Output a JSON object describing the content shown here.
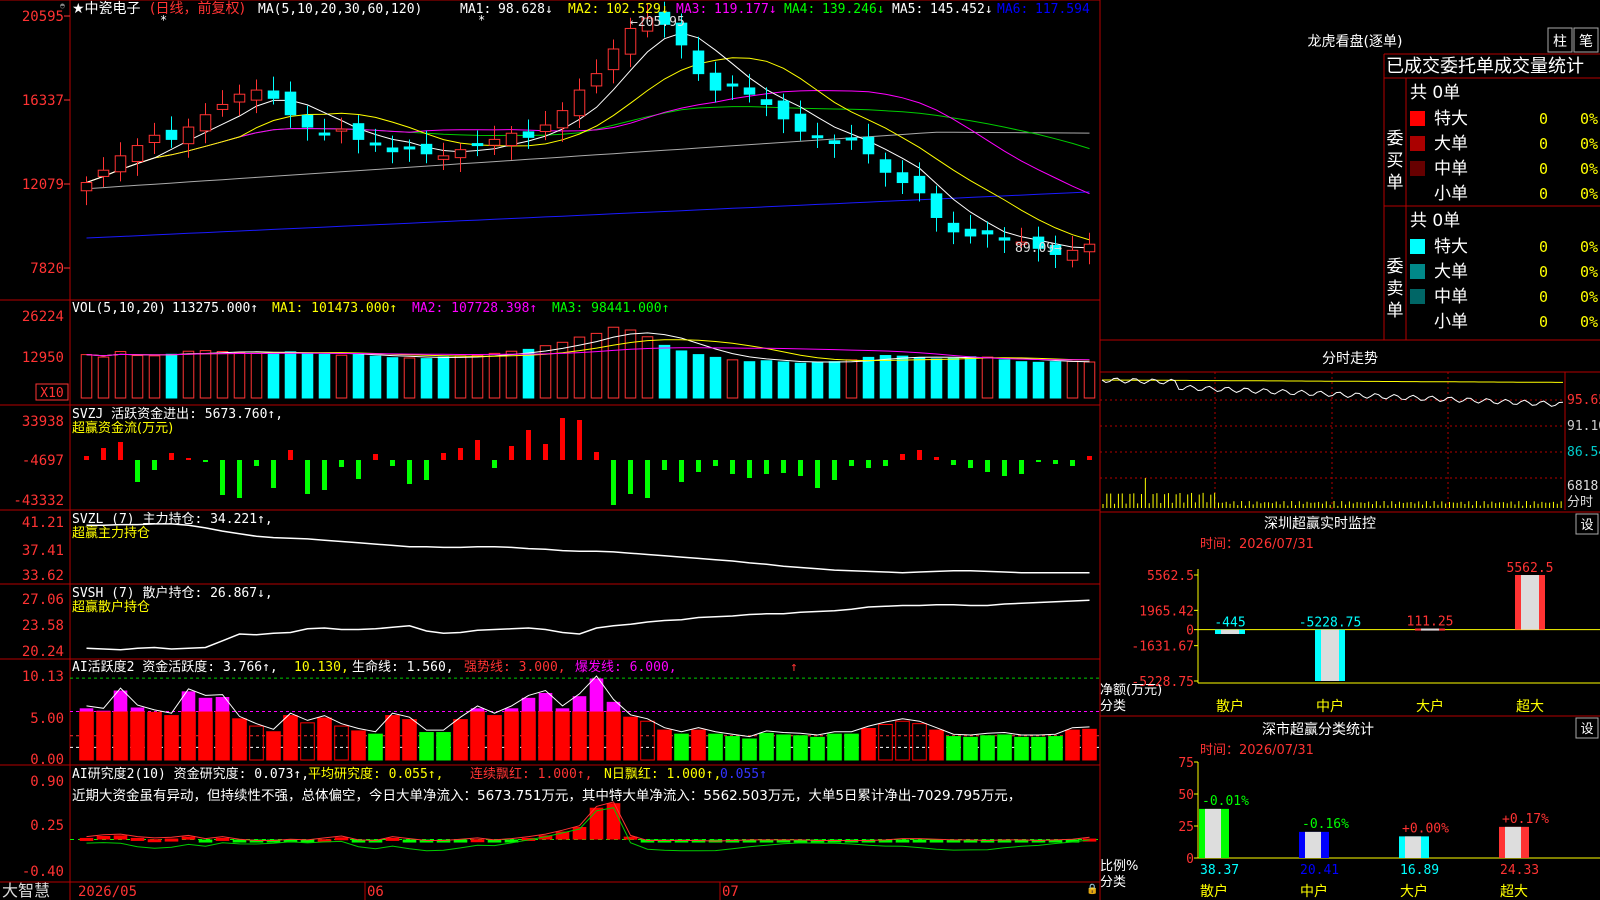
{
  "stock": {
    "star": "★",
    "name": "中瓷电子",
    "period_note": "(日线，前复权)",
    "ma_params": "MA(5,10,20,30,60,120)",
    "ma_readouts": [
      {
        "label": "MA1:",
        "value": "98.628↓",
        "color": "#ffffff"
      },
      {
        "label": "MA2:",
        "value": "102.529↓",
        "color": "#ffff00"
      },
      {
        "label": "MA3:",
        "value": "119.177↓",
        "color": "#ff00ff"
      },
      {
        "label": "MA4:",
        "value": "139.246↓",
        "color": "#00ff00"
      },
      {
        "label": "MA5:",
        "value": "145.452↓",
        "color": "#ffffff"
      },
      {
        "label": "MA6:",
        "value": "117.594",
        "color": "#0000ff"
      }
    ],
    "price_high_label": "←205.95",
    "price_low_label": "89.09→"
  },
  "price_axis": [
    "20595",
    "16337",
    "12079",
    "7820"
  ],
  "volume": {
    "header": "VOL(5,10,20)",
    "value": "113275.000↑",
    "ma1": "MA1: 101473.000↑",
    "ma2": "MA2: 107728.398↑",
    "ma3": "MA3: 98441.000↑",
    "axis": [
      "26224",
      "12950"
    ],
    "unit": "X10"
  },
  "svzj": {
    "header": "SVZJ  活跃资金进出: 5673.760↑,",
    "sub": "超赢资金流(万元)",
    "axis": [
      "33938",
      "-4697",
      "-43332"
    ]
  },
  "svzl": {
    "header": "SVZL (7) 主力持仓: 34.221↑,",
    "sub": "超赢主力持仓",
    "axis": [
      "41.21",
      "37.41",
      "33.62"
    ]
  },
  "svsh": {
    "header": "SVSH (7) 散户持仓: 26.867↓,",
    "sub": "超赢散户持仓",
    "axis": [
      "27.06",
      "23.58",
      "20.24"
    ]
  },
  "ai_active": {
    "header_a": "AI活跃度2 资金活跃度: 3.766↑, ",
    "header_b": "10.130,",
    "header_c": " 生命线: 1.560,",
    "header_d": " 强势线: 3.000,",
    "header_e": " 爆发线: 6.000,",
    "axis": [
      "10.13",
      "5.00",
      "0.00"
    ]
  },
  "ai_research": {
    "h1": "AI研究度2(10) 资金研究度: 0.073↑,",
    "h2": " 平均研究度: 0.055↑,",
    "h3": " 连续飘红: 1.000↑,",
    "h4": " N日飘红: 1.000↑,",
    "h5": " 0.055↑",
    "comment": "近期大资金虽有异动，但持续性不强，总体偏空，今日大单净流入：5673.751万元，其中特大单净流入：5562.503万元，大单5日累计净出-7029.795万元，",
    "axis": [
      "0.90",
      "0.25",
      "-0.40"
    ]
  },
  "date_axis": [
    "2026/05",
    "06",
    "07"
  ],
  "brand": "大智慧",
  "right": {
    "lhb_title": "龙虎看盘(逐单)",
    "btn_zhu": "柱",
    "btn_bi": "笔",
    "table_title": "已成交委托单成交量统计",
    "buy_label": "委买单",
    "sell_label": "委卖单",
    "buy_total": "共 0单",
    "sell_total": "共 0单",
    "buy_rows": [
      {
        "name": "特大",
        "count": "0",
        "pct": "0%",
        "color": "#ff0000"
      },
      {
        "name": "大单",
        "count": "0",
        "pct": "0%",
        "color": "#aa0000"
      },
      {
        "name": "中单",
        "count": "0",
        "pct": "0%",
        "color": "#660000"
      },
      {
        "name": "小单",
        "count": "0",
        "pct": "0%",
        "color": "#000000"
      }
    ],
    "sell_rows": [
      {
        "name": "特大",
        "count": "0",
        "pct": "0%",
        "color": "#00ffff"
      },
      {
        "name": "大单",
        "count": "0",
        "pct": "0%",
        "color": "#008888"
      },
      {
        "name": "中单",
        "count": "0",
        "pct": "0%",
        "color": "#006666"
      },
      {
        "name": "小单",
        "count": "0",
        "pct": "0%",
        "color": "#000000"
      }
    ],
    "intraday_title": "分时走势",
    "intraday_axis": [
      "95.65",
      "91.10",
      "86.54"
    ],
    "intraday_vol": "6818",
    "intraday_vol_unit": "分时",
    "sz_title": "深圳超赢实时监控",
    "sz_time": "时间：2026/07/31",
    "sz_axis": [
      "5562.5",
      "1965.42",
      "0",
      "-1631.67",
      "-5228.75"
    ],
    "sz_ylabel": "净额(万元)",
    "sz_xlabel": "分类",
    "sz_bars": [
      {
        "cat": "散户",
        "value": -445,
        "label": "-445"
      },
      {
        "cat": "中户",
        "value": -5228.75,
        "label": "-5228.75"
      },
      {
        "cat": "大户",
        "value": 111.25,
        "label": "111.25"
      },
      {
        "cat": "超大",
        "value": 5562.5,
        "label": "5562.5"
      }
    ],
    "cls_title": "深市超赢分类统计",
    "cls_time": "时间：2026/07/31",
    "cls_axis": [
      "75",
      "50",
      "25",
      "0"
    ],
    "cls_ylabel": "比例%",
    "cls_xlabel": "分类",
    "cls_bars": [
      {
        "cat": "散户",
        "value": 38.37,
        "label": "38.37",
        "chg": "-0.01%"
      },
      {
        "cat": "中户",
        "value": 20.41,
        "label": "20.41",
        "chg": "-0.16%"
      },
      {
        "cat": "大户",
        "value": 16.89,
        "label": "16.89",
        "chg": "+0.00%"
      },
      {
        "cat": "超大",
        "value": 24.33,
        "label": "24.33",
        "chg": "+0.17%"
      }
    ],
    "set_label": "设"
  },
  "colors": {
    "up": "#ff3333",
    "down": "#00ffff",
    "grid": "#b40000",
    "axis_text": "#ff3333",
    "green": "#00ff00"
  },
  "chart_data": {
    "type": "candlestick",
    "closes": [
      125,
      131,
      138,
      143,
      148,
      146,
      152,
      158,
      163,
      168,
      170,
      166,
      158,
      152,
      149,
      151,
      146,
      144,
      140,
      142,
      139,
      138,
      141,
      143,
      146,
      149,
      147,
      153,
      160,
      170,
      178,
      190,
      200,
      205,
      202,
      192,
      178,
      170,
      172,
      168,
      163,
      156,
      150,
      147,
      144,
      146,
      139,
      130,
      125,
      120,
      108,
      101,
      99,
      100,
      97,
      96,
      93,
      90,
      92,
      95
    ],
    "volumes": [
      141,
      133,
      151,
      138,
      137,
      142,
      152,
      154,
      151,
      148,
      145,
      147,
      150,
      146,
      142,
      139,
      141,
      136,
      131,
      130,
      128,
      133,
      137,
      139,
      145,
      152,
      158,
      170,
      181,
      198,
      210,
      230,
      221,
      199,
      171,
      153,
      141,
      132,
      124,
      118,
      121,
      117,
      113,
      116,
      118,
      124,
      132,
      138,
      136,
      131,
      127,
      129,
      134,
      133,
      124,
      118,
      116,
      118,
      119,
      117
    ],
    "svzj": [
      4,
      12,
      18,
      -22,
      -10,
      7,
      2,
      -2,
      -35,
      -38,
      -6,
      -28,
      10,
      -34,
      -30,
      -7,
      -19,
      6,
      -6,
      -24,
      -20,
      7,
      12,
      20,
      -8,
      14,
      30,
      16,
      42,
      40,
      8,
      -45,
      -34,
      -38,
      -10,
      -22,
      -12,
      -6,
      -14,
      -18,
      -14,
      -13,
      -16,
      -28,
      -20,
      -6,
      -8,
      -6,
      6,
      10,
      3,
      -5,
      -8,
      -12,
      -16,
      -14,
      -2,
      -4,
      -6,
      4
    ],
    "svzl": [
      40.9,
      40.9,
      41.0,
      41.0,
      41.1,
      41.1,
      40.9,
      40.5,
      40.0,
      39.6,
      39.2,
      39.0,
      38.9,
      38.8,
      38.6,
      38.4,
      38.2,
      38.0,
      37.8,
      37.6,
      37.6,
      37.5,
      37.5,
      37.6,
      37.6,
      37.5,
      37.3,
      37.2,
      37.0,
      36.9,
      36.9,
      36.8,
      36.6,
      36.4,
      36.2,
      36.0,
      35.8,
      35.6,
      35.4,
      35.1,
      34.9,
      34.6,
      34.4,
      34.2,
      34.0,
      33.9,
      33.8,
      33.7,
      33.6,
      33.7,
      33.8,
      33.9,
      33.9,
      33.8,
      33.7,
      33.6,
      33.6,
      33.6,
      33.6,
      33.6
    ],
    "svsh": [
      20.5,
      20.4,
      20.3,
      20.5,
      20.6,
      20.4,
      20.5,
      20.6,
      21.5,
      22.4,
      22.3,
      22.5,
      22.6,
      23.1,
      23.2,
      23.0,
      23.0,
      23.1,
      23.3,
      23.5,
      22.8,
      22.5,
      22.6,
      22.9,
      23.0,
      23.1,
      23.2,
      23.0,
      22.6,
      22.4,
      23.2,
      23.5,
      23.7,
      24.0,
      24.2,
      24.3,
      24.6,
      24.7,
      24.8,
      25.0,
      25.1,
      25.1,
      25.3,
      25.4,
      25.5,
      25.7,
      26.0,
      26.1,
      26.2,
      26.2,
      26.3,
      26.3,
      26.2,
      26.2,
      26.4,
      26.5,
      26.6,
      26.7,
      26.8,
      26.9
    ],
    "ai_active": [
      6.4,
      6.1,
      8.6,
      6.5,
      5.9,
      5.5,
      8.5,
      7.7,
      7.8,
      5.1,
      4.2,
      3.5,
      5.5,
      4.6,
      5.2,
      4.2,
      3.6,
      3.2,
      5.5,
      5.0,
      3.4,
      3.4,
      5.0,
      6.4,
      5.5,
      6.4,
      7.7,
      8.3,
      6.4,
      7.9,
      10.1,
      7.2,
      5.3,
      4.8,
      3.7,
      3.2,
      3.7,
      3.2,
      2.9,
      2.6,
      3.3,
      3.1,
      3.0,
      2.8,
      3.2,
      3.2,
      3.9,
      4.4,
      4.8,
      4.5,
      3.7,
      2.9,
      2.8,
      3.0,
      3.1,
      2.8,
      2.8,
      2.9,
      3.7,
      3.8
    ],
    "ai_research": [
      0.08,
      0.11,
      0.12,
      0.08,
      0.06,
      0.07,
      0.1,
      0.05,
      0.08,
      0.04,
      0.02,
      0.02,
      0.04,
      0.03,
      0.06,
      0.09,
      0.03,
      0.02,
      0.08,
      0.05,
      0.02,
      0.02,
      0.04,
      0.06,
      0.03,
      0.05,
      0.08,
      0.12,
      0.18,
      0.25,
      0.55,
      0.62,
      0.1,
      0.02,
      0.02,
      0.02,
      0.02,
      0.01,
      0.02,
      0.03,
      0.03,
      0.03,
      0.03,
      0.02,
      0.02,
      0.02,
      0.02,
      0.03,
      0.05,
      0.05,
      0.04,
      0.03,
      0.03,
      0.02,
      0.03,
      0.03,
      0.02,
      0.03,
      0.04,
      0.07
    ]
  }
}
